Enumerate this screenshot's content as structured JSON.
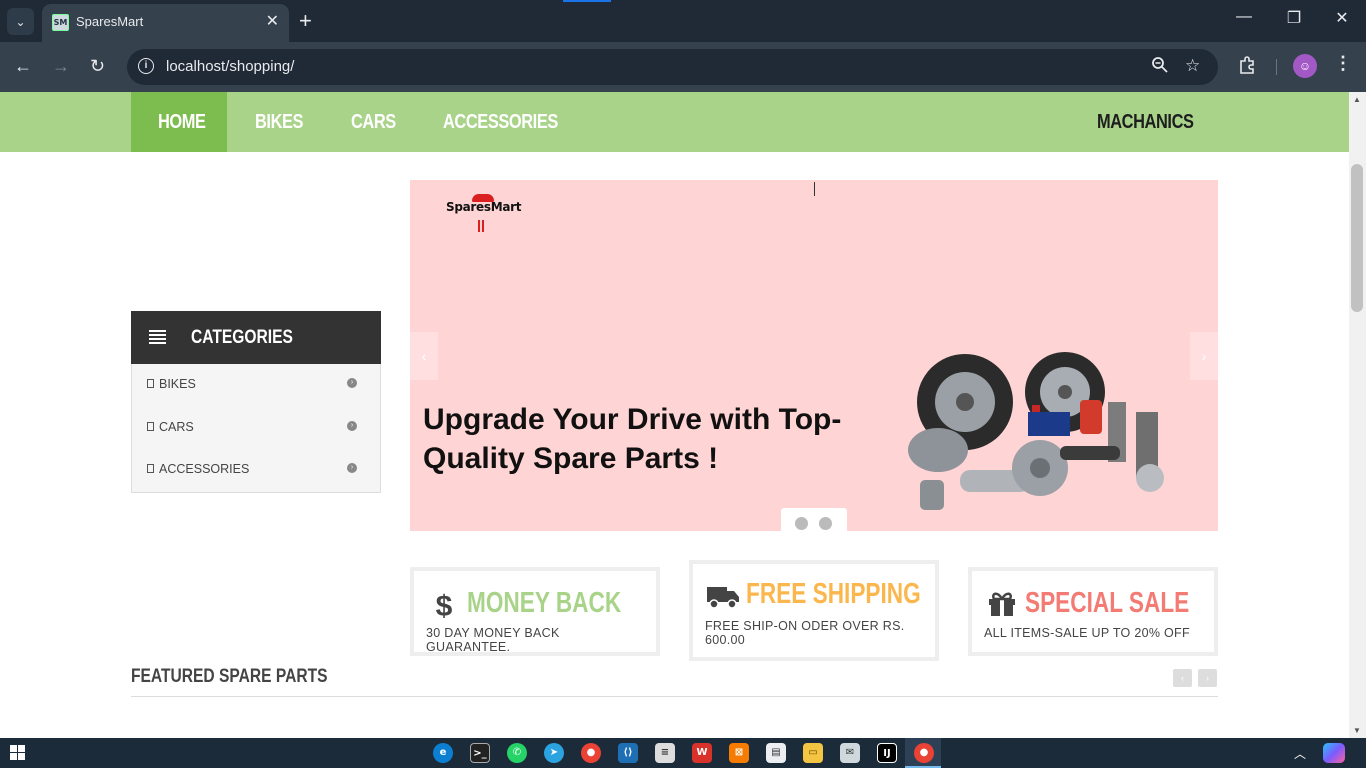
{
  "browser": {
    "tab_title": "SparesMart",
    "favicon_text": "SM",
    "url": "localhost/shopping/"
  },
  "site": {
    "nav": {
      "home": "HOME",
      "bikes": "BIKES",
      "cars": "CARS",
      "accessories": "ACCESSORIES",
      "mechanics": "MACHANICS"
    },
    "categories": {
      "title": "CATEGORIES",
      "items": [
        {
          "label": "BIKES"
        },
        {
          "label": "CARS"
        },
        {
          "label": "ACCESSORIES"
        }
      ]
    },
    "banner": {
      "logo_text": "SparesMart",
      "headline": "Upgrade Your Drive with Top-Quality Spare Parts !"
    },
    "features": [
      {
        "title": "MONEY BACK",
        "subtitle": "30 DAY MONEY BACK GUARANTEE.",
        "color": "#a8d389"
      },
      {
        "title": "FREE SHIPPING",
        "subtitle": "FREE SHIP-ON ODER OVER RS. 600.00",
        "color": "#fbb64d"
      },
      {
        "title": "SPECIAL SALE",
        "subtitle": "ALL ITEMS-SALE UP TO 20% OFF",
        "color": "#f47b74"
      }
    ],
    "featured": {
      "title": "FEATURED SPARE PARTS"
    }
  },
  "colors": {
    "nav_bg": "#a8d389",
    "nav_active": "#7dbc4f",
    "banner_bg": "#ffd4d4",
    "category_header": "#333333"
  }
}
